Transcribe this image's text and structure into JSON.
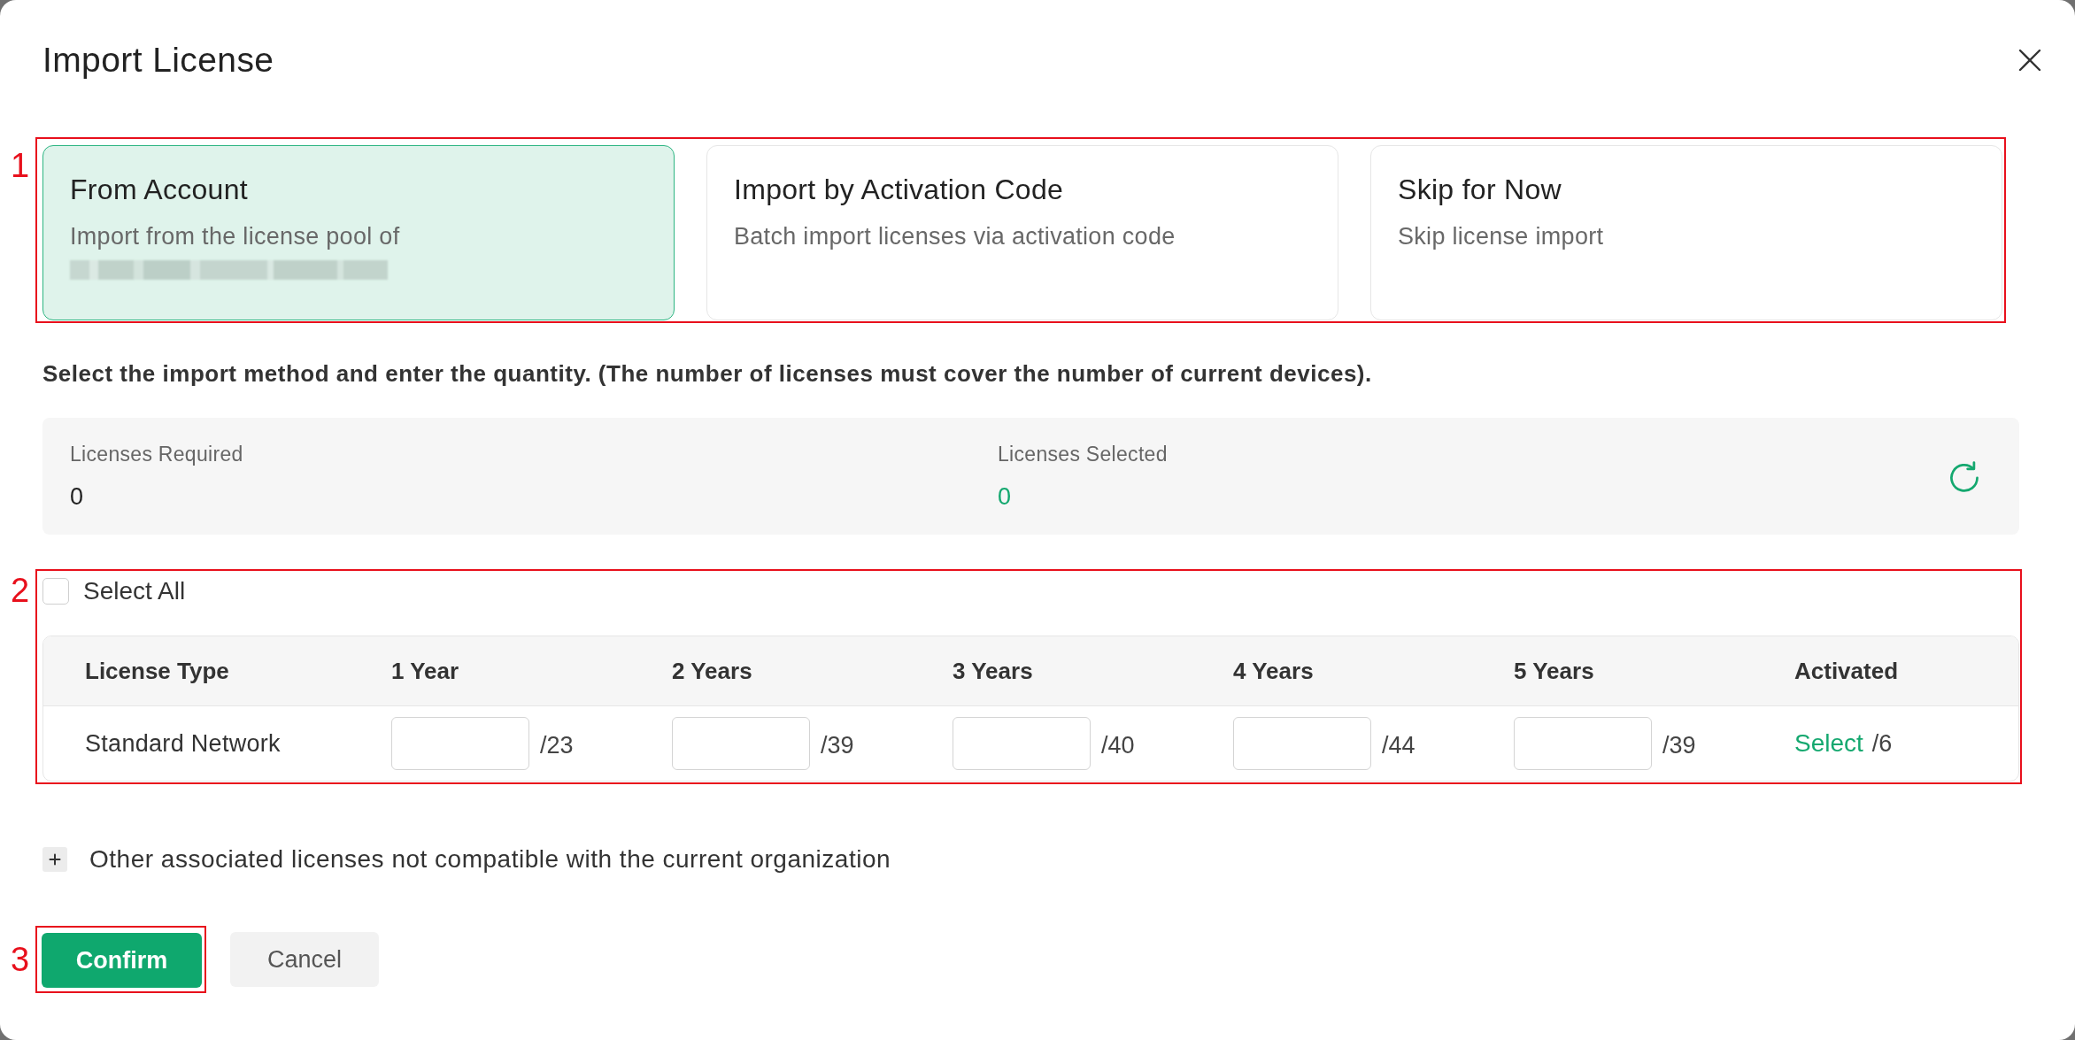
{
  "dialog": {
    "title": "Import License"
  },
  "callouts": [
    "1",
    "2",
    "3"
  ],
  "import_methods": [
    {
      "title": "From Account",
      "description": "Import from the license pool of",
      "redacted_line": true,
      "selected": true
    },
    {
      "title": "Import by Activation Code",
      "description": "Batch import licenses via activation code",
      "selected": false
    },
    {
      "title": "Skip for Now",
      "description": "Skip license import",
      "selected": false
    }
  ],
  "instruction": "Select the import method and enter the quantity. (The number of licenses must cover the number of current devices).",
  "summary": [
    {
      "label": "Licenses Required",
      "value": "0",
      "kind": "plain"
    },
    {
      "label": "Licenses Selected",
      "value": "0",
      "kind": "accent"
    }
  ],
  "select_all": {
    "label": "Select All",
    "checked": false
  },
  "table": {
    "columns": [
      "License Type",
      "1 Year",
      "2 Years",
      "3 Years",
      "4 Years",
      "5 Years",
      "Activated"
    ],
    "rows": [
      {
        "license_type": "Standard Network",
        "quantities": [
          {
            "available": "/23"
          },
          {
            "available": "/39"
          },
          {
            "available": "/40"
          },
          {
            "available": "/44"
          },
          {
            "available": "/39"
          }
        ],
        "activated": {
          "link": "Select",
          "count": "/6"
        }
      }
    ]
  },
  "other_licenses": {
    "label": "Other associated licenses not compatible with the current organization",
    "expanded": false
  },
  "buttons": [
    {
      "label": "Confirm",
      "kind": "primary"
    },
    {
      "label": "Cancel",
      "kind": "secondary"
    }
  ]
}
